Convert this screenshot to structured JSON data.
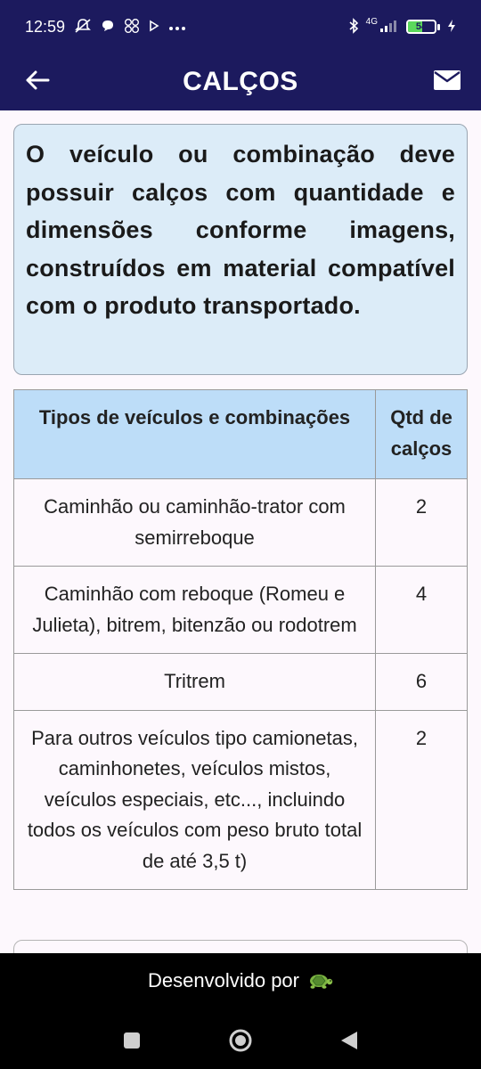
{
  "status_bar": {
    "time": "12:59",
    "network": "4G",
    "battery": "54",
    "battery_level": 0.54,
    "battery_fill_color": "#5bd95b"
  },
  "app_bar": {
    "title": "CALÇOS",
    "background": "#1c1a5e"
  },
  "info": {
    "text": "O veículo ou combinação deve possuir calços com quantidade e dimensões conforme imagens, construídos em material compatível com o produto transportado."
  },
  "table": {
    "headers": [
      "Tipos de veículos e combinações",
      "Qtd de calços"
    ],
    "rows": [
      {
        "type": "Caminhão ou caminhão-trator com semirreboque",
        "qty": "2"
      },
      {
        "type": "Caminhão com reboque (Romeu e Julieta), bitrem, bitenzão ou rodotrem",
        "qty": "4"
      },
      {
        "type": "Tritrem",
        "qty": "6"
      },
      {
        "type": "Para outros veículos tipo camionetas, caminhonetes, veículos mistos, veículos especiais, etc..., incluindo todos os veículos com peso bruto total de até 3,5 t)",
        "qty": "2"
      }
    ],
    "header_background": "#bdddf8"
  },
  "footer": {
    "credit": "Desenvolvido por",
    "credit_icon": "turtle-icon"
  },
  "icons": {
    "back": "arrow-left-icon",
    "mail": "mail-icon",
    "nav_recents": "square-icon",
    "nav_home": "circle-icon",
    "nav_back": "triangle-icon"
  }
}
